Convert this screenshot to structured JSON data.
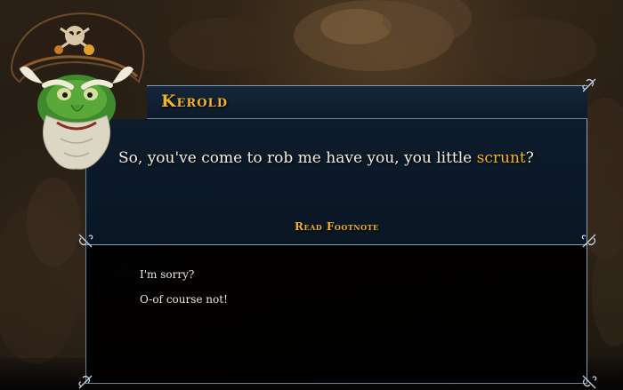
{
  "speaker": {
    "name": "Kerold"
  },
  "dialog": {
    "text_before": "So, you've come to rob me have you, you little ",
    "keyword": "scrunt",
    "text_after": "?",
    "footnote_label": "Read Footnote"
  },
  "responses": [
    {
      "label": "I'm sorry?"
    },
    {
      "label": "O-of course not!"
    }
  ],
  "colors": {
    "accent_gold": "#f2b324",
    "panel_navy": "#0d1b2b",
    "frame_silver": "#8aa0b6"
  },
  "icons": {
    "portrait": "pirate-character-portrait-icon",
    "corner": "ornate-corner-icon"
  }
}
